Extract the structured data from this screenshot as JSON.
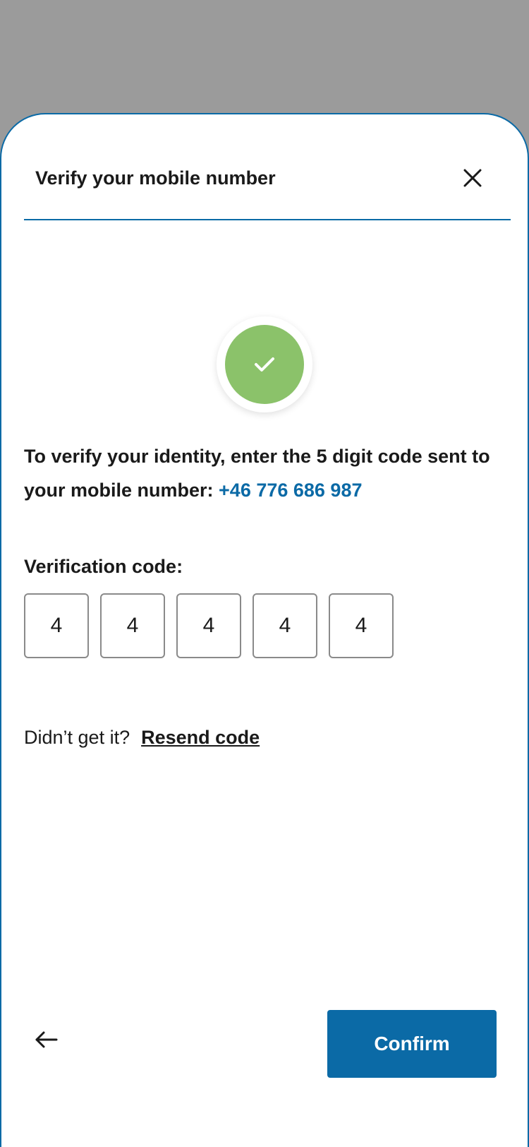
{
  "header": {
    "title": "Verify your mobile number",
    "close_icon": "close-icon"
  },
  "status": {
    "icon": "checkmark-icon",
    "color": "#8bc26a"
  },
  "instructions": {
    "text": "To verify your identity, enter the 5 digit code sent to your mobile number: ",
    "phone_number": "+46 776 686 987"
  },
  "verification": {
    "label": "Verification code:",
    "digits": [
      "4",
      "4",
      "4",
      "4",
      "4"
    ]
  },
  "resend": {
    "prompt": "Didn’t get it?",
    "link_label": "Resend code"
  },
  "footer": {
    "back_icon": "arrow-left-icon",
    "confirm_label": "Confirm"
  },
  "colors": {
    "accent": "#0b6aa6",
    "overlay": "#9b9b9b",
    "success": "#8bc26a"
  }
}
